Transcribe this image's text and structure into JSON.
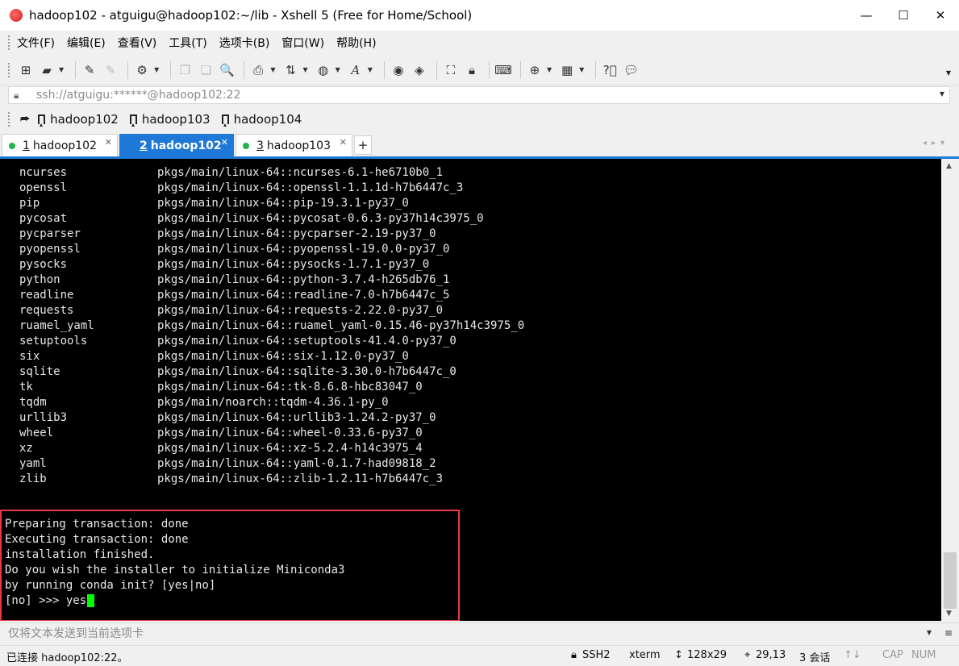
{
  "window": {
    "title": "hadoop102 - atguigu@hadoop102:~/lib - Xshell 5 (Free for Home/School)",
    "buttons": {
      "minimize": "—",
      "maximize": "☐",
      "close": "✕"
    }
  },
  "menu": [
    "文件(F)",
    "编辑(E)",
    "查看(V)",
    "工具(T)",
    "选项卡(B)",
    "窗口(W)",
    "帮助(H)"
  ],
  "address": {
    "value": "ssh://atguigu:******@hadoop102:22"
  },
  "links": [
    "hadoop102",
    "hadoop103",
    "hadoop104"
  ],
  "tabs": [
    {
      "num": "1",
      "label": "hadoop102",
      "active": false
    },
    {
      "num": "2",
      "label": "hadoop102",
      "active": true
    },
    {
      "num": "3",
      "label": "hadoop103",
      "active": false
    }
  ],
  "terminal": {
    "packages": [
      {
        "name": "ncurses",
        "source": "pkgs/main/linux-64::ncurses-6.1-he6710b0_1"
      },
      {
        "name": "openssl",
        "source": "pkgs/main/linux-64::openssl-1.1.1d-h7b6447c_3"
      },
      {
        "name": "pip",
        "source": "pkgs/main/linux-64::pip-19.3.1-py37_0"
      },
      {
        "name": "pycosat",
        "source": "pkgs/main/linux-64::pycosat-0.6.3-py37h14c3975_0"
      },
      {
        "name": "pycparser",
        "source": "pkgs/main/linux-64::pycparser-2.19-py37_0"
      },
      {
        "name": "pyopenssl",
        "source": "pkgs/main/linux-64::pyopenssl-19.0.0-py37_0"
      },
      {
        "name": "pysocks",
        "source": "pkgs/main/linux-64::pysocks-1.7.1-py37_0"
      },
      {
        "name": "python",
        "source": "pkgs/main/linux-64::python-3.7.4-h265db76_1"
      },
      {
        "name": "readline",
        "source": "pkgs/main/linux-64::readline-7.0-h7b6447c_5"
      },
      {
        "name": "requests",
        "source": "pkgs/main/linux-64::requests-2.22.0-py37_0"
      },
      {
        "name": "ruamel_yaml",
        "source": "pkgs/main/linux-64::ruamel_yaml-0.15.46-py37h14c3975_0"
      },
      {
        "name": "setuptools",
        "source": "pkgs/main/linux-64::setuptools-41.4.0-py37_0"
      },
      {
        "name": "six",
        "source": "pkgs/main/linux-64::six-1.12.0-py37_0"
      },
      {
        "name": "sqlite",
        "source": "pkgs/main/linux-64::sqlite-3.30.0-h7b6447c_0"
      },
      {
        "name": "tk",
        "source": "pkgs/main/linux-64::tk-8.6.8-hbc83047_0"
      },
      {
        "name": "tqdm",
        "source": "pkgs/main/noarch::tqdm-4.36.1-py_0"
      },
      {
        "name": "urllib3",
        "source": "pkgs/main/linux-64::urllib3-1.24.2-py37_0"
      },
      {
        "name": "wheel",
        "source": "pkgs/main/linux-64::wheel-0.33.6-py37_0"
      },
      {
        "name": "xz",
        "source": "pkgs/main/linux-64::xz-5.2.4-h14c3975_4"
      },
      {
        "name": "yaml",
        "source": "pkgs/main/linux-64::yaml-0.1.7-had09818_2"
      },
      {
        "name": "zlib",
        "source": "pkgs/main/linux-64::zlib-1.2.11-h7b6447c_3"
      }
    ],
    "output": [
      "Preparing transaction: done",
      "Executing transaction: done",
      "installation finished.",
      "Do you wish the installer to initialize Miniconda3",
      "by running conda init? [yes|no]"
    ],
    "prompt": "[no] >>> ",
    "input": "yes",
    "cursor_color": "#00ff00",
    "highlight_color": "#e8393f"
  },
  "compose": {
    "placeholder": "仅将文本发送到当前选项卡"
  },
  "status": {
    "connection": "已连接 hadoop102:22。",
    "protocol": "SSH2",
    "terminal_type": "xterm",
    "size": "128x29",
    "cursor_pos": "29,13",
    "sessions": "3 会话",
    "caps": "CAP",
    "num": "NUM"
  },
  "colors": {
    "accent": "#1e78d7",
    "tab_dot": "#22b14c"
  }
}
